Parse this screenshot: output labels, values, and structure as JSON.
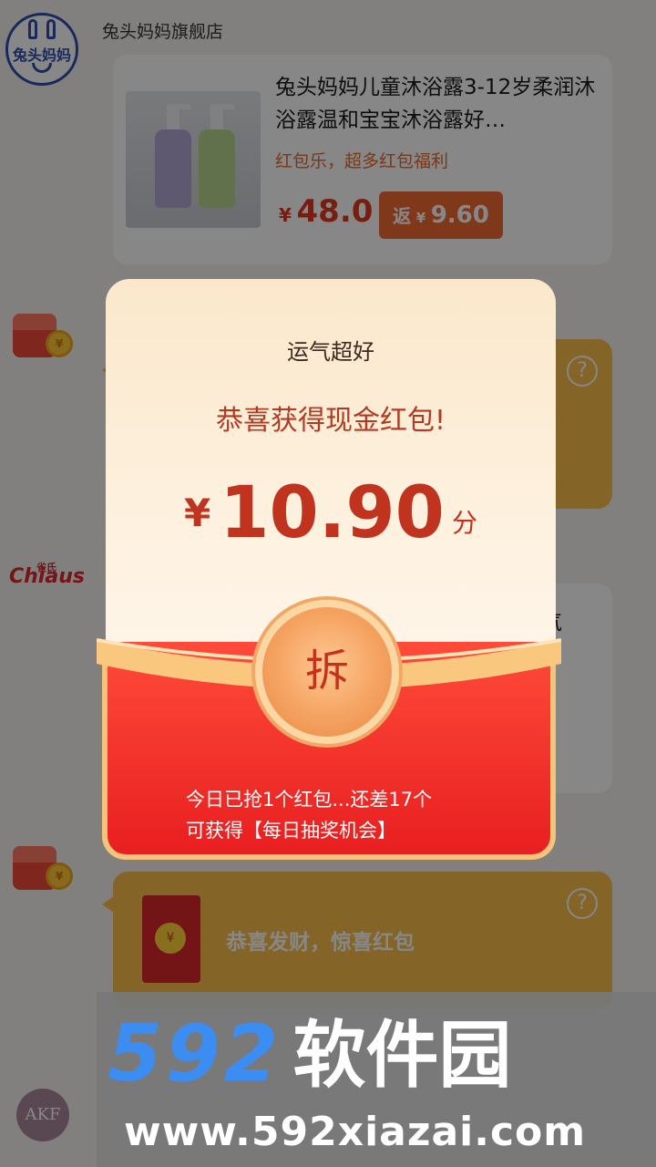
{
  "store": {
    "name": "兔头妈妈旗舰店",
    "avatar_text": "兔头妈妈"
  },
  "product": {
    "title": "兔头妈妈儿童沐浴露3-12岁柔润沐浴露温和宝宝沐浴露好…",
    "promo": "红包乐，超多红包福利",
    "price_currency": "¥",
    "price": "48.0",
    "rebate_label": "返",
    "rebate_currency": "¥",
    "rebate_amount": "9.60"
  },
  "background_cards": {
    "help_glyph": "?",
    "brand_text": "Chiaus",
    "brand_small": "雀氏",
    "card2_text_line1": "气",
    "card2_text_line2": "…",
    "card3_message": "恭喜发财，惊喜红包",
    "coin_glyph": "¥",
    "env_coin_glyph": "¥",
    "akf_text": "AKF"
  },
  "modal": {
    "lucky": "运气超好",
    "congrats": "恭喜获得现金红包!",
    "currency": "¥",
    "amount": "10.90",
    "unit": "分",
    "open_label": "拆",
    "notice_line1": "今日已抢1个红包...还差17个",
    "notice_line2": "可获得【每日抽奖机会】"
  },
  "watermark": {
    "logo_number": "592",
    "logo_text": "软件园",
    "url": "www.592xiazai.com"
  },
  "colors": {
    "accent_orange": "#f26b33",
    "price_red": "#e33a20",
    "envelope_red": "#e81f20",
    "card_yellow": "#fbbd4b",
    "watermark_blue": "#3b8df2"
  }
}
